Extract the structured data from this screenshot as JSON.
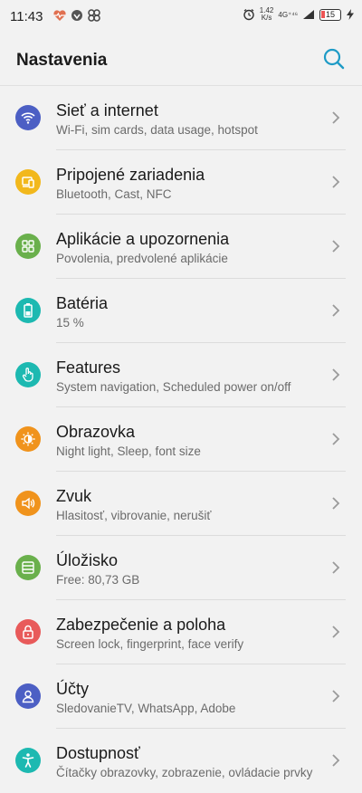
{
  "status_bar": {
    "time": "11:43",
    "speed_value": "1.42",
    "speed_unit": "K/s",
    "network": "4G⁺⁴⁶",
    "battery": "15"
  },
  "header": {
    "title": "Nastavenia",
    "search_icon": "search-icon"
  },
  "colors": {
    "accent": "#1e9bc6",
    "network": "#4c5fc4",
    "devices": "#f2b81c",
    "apps": "#6ab04c",
    "battery": "#1db9b1",
    "features": "#1db9b1",
    "display": "#f0931c",
    "sound": "#f0931c",
    "storage": "#6ab04c",
    "security": "#e85a5a",
    "accounts": "#4c5fc4",
    "accessibility": "#1db9b1"
  },
  "items": [
    {
      "icon": "wifi-icon",
      "title": "Sieť a internet",
      "subtitle": "Wi-Fi, sim cards, data usage, hotspot"
    },
    {
      "icon": "devices-icon",
      "title": "Pripojené zariadenia",
      "subtitle": "Bluetooth, Cast, NFC"
    },
    {
      "icon": "apps-grid-icon",
      "title": "Aplikácie a upozornenia",
      "subtitle": "Povolenia, predvolené aplikácie"
    },
    {
      "icon": "battery-icon",
      "title": "Batéria",
      "subtitle": "15 %"
    },
    {
      "icon": "hand-pointer-icon",
      "title": "Features",
      "subtitle": "System navigation, Scheduled power on/off"
    },
    {
      "icon": "brightness-icon",
      "title": "Obrazovka",
      "subtitle": "Night light, Sleep, font size"
    },
    {
      "icon": "volume-icon",
      "title": "Zvuk",
      "subtitle": "Hlasitosť, vibrovanie, nerušiť"
    },
    {
      "icon": "storage-icon",
      "title": "Úložisko",
      "subtitle": "Free: 80,73 GB"
    },
    {
      "icon": "lock-icon",
      "title": "Zabezpečenie a poloha",
      "subtitle": "Screen lock, fingerprint, face verify"
    },
    {
      "icon": "account-icon",
      "title": "Účty",
      "subtitle": "SledovanieTV, WhatsApp, Adobe"
    },
    {
      "icon": "accessibility-icon",
      "title": "Dostupnosť",
      "subtitle": "Čítačky obrazovky, zobrazenie, ovládacie prvky"
    }
  ]
}
